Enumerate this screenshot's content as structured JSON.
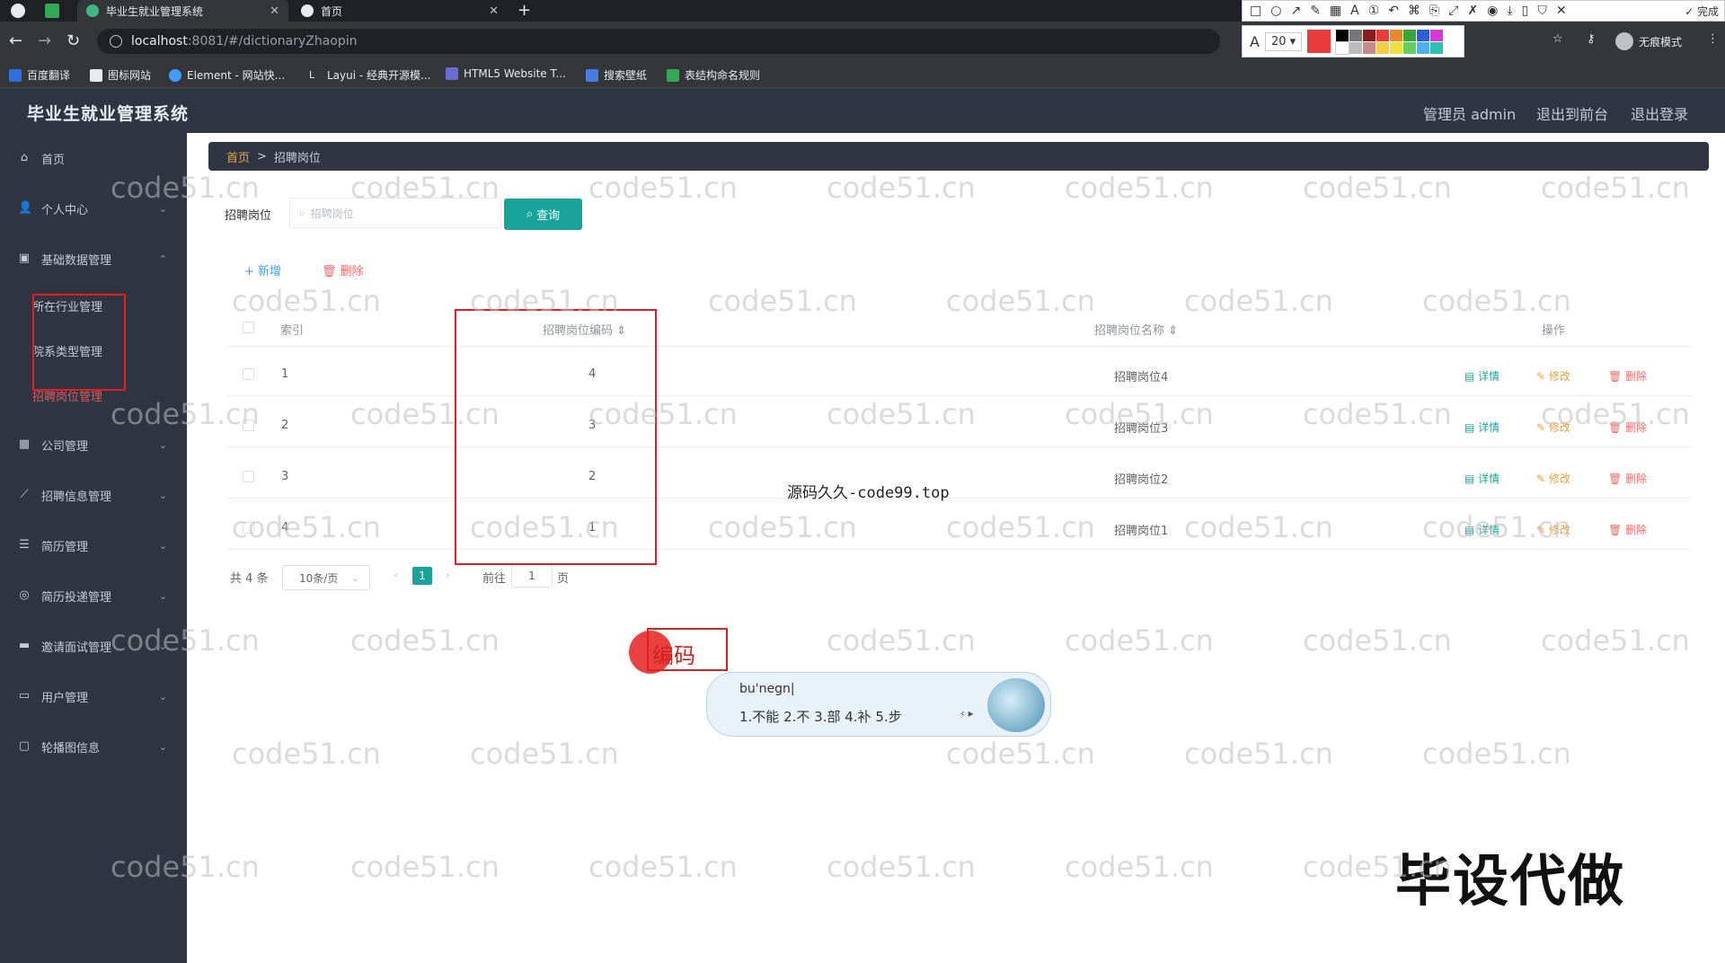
{
  "browser": {
    "tabs": [
      {
        "title": "毕业生就业管理系统",
        "active": true
      },
      {
        "title": "首页",
        "active": false
      }
    ],
    "url_host": "localhost",
    "url_path": ":8081/#/dictionaryZhaopin",
    "incognito_label": "无痕模式",
    "bookmarks": [
      "百度翻译",
      "图标网站",
      "Element - 网站快...",
      "Layui - 经典开源模...",
      "HTML5 Website T...",
      "搜索壁纸",
      "表结构命名规则"
    ],
    "colors": {
      "chrome_dark": "#202124",
      "chrome_mid": "#35363a"
    }
  },
  "annotation_toolbar": {
    "font_size": "20",
    "done_label": "完成",
    "main_color": "#e93b3b"
  },
  "app": {
    "title": "毕业生就业管理系统",
    "header_links": [
      "管理员 admin",
      "退出到前台",
      "退出登录"
    ],
    "colors": {
      "nav_bg": "#2f3542",
      "accent_teal": "#1aa39a",
      "active_menu": "#e05a5a"
    }
  },
  "sidebar": {
    "items": [
      {
        "label": "首页",
        "icon": "home-icon",
        "chevron": false
      },
      {
        "label": "个人中心",
        "icon": "user-icon",
        "chevron": true
      },
      {
        "label": "基础数据管理",
        "icon": "data-icon",
        "chevron": true,
        "expanded": true
      },
      {
        "label": "公司管理",
        "icon": "grid-icon",
        "chevron": true
      },
      {
        "label": "招聘信息管理",
        "icon": "chart-icon",
        "chevron": true
      },
      {
        "label": "简历管理",
        "icon": "list-icon",
        "chevron": true
      },
      {
        "label": "简历投递管理",
        "icon": "send-icon",
        "chevron": true
      },
      {
        "label": "邀请面试管理",
        "icon": "chat-icon",
        "chevron": true
      },
      {
        "label": "用户管理",
        "icon": "monitor-icon",
        "chevron": true
      },
      {
        "label": "轮播图信息",
        "icon": "message-icon",
        "chevron": true
      }
    ],
    "subitems": [
      "所在行业管理",
      "院系类型管理",
      "招聘岗位管理"
    ]
  },
  "breadcrumb": {
    "home": "首页",
    "sep": ">",
    "current": "招聘岗位"
  },
  "search": {
    "label": "招聘岗位",
    "placeholder": "招聘岗位",
    "button": "查询"
  },
  "actions": {
    "add": "新增",
    "delete": "删除"
  },
  "table": {
    "headers": {
      "index": "索引",
      "code": "招聘岗位编码",
      "name": "招聘岗位名称",
      "ops": "操作"
    },
    "rows": [
      {
        "index": "1",
        "code": "4",
        "name": "招聘岗位4"
      },
      {
        "index": "2",
        "code": "3",
        "name": "招聘岗位3"
      },
      {
        "index": "3",
        "code": "2",
        "name": "招聘岗位2"
      },
      {
        "index": "4",
        "code": "1",
        "name": "招聘岗位1"
      }
    ],
    "row_actions": {
      "detail": "详情",
      "edit": "修改",
      "delete": "删除"
    }
  },
  "pagination": {
    "total": "共 4 条",
    "page_size": "10条/页",
    "current": "1",
    "goto_label": "前往",
    "goto_value": "1",
    "page_suffix": "页"
  },
  "overlays": {
    "watermark": "code51.cn",
    "source_text": "源码久久-code99.top",
    "big_text": "毕设代做",
    "ime_typed": "编码",
    "ime_pinyin": "bu'negn|",
    "ime_candidates": "1.不能   2.不   3.部   4.补   5.步"
  }
}
